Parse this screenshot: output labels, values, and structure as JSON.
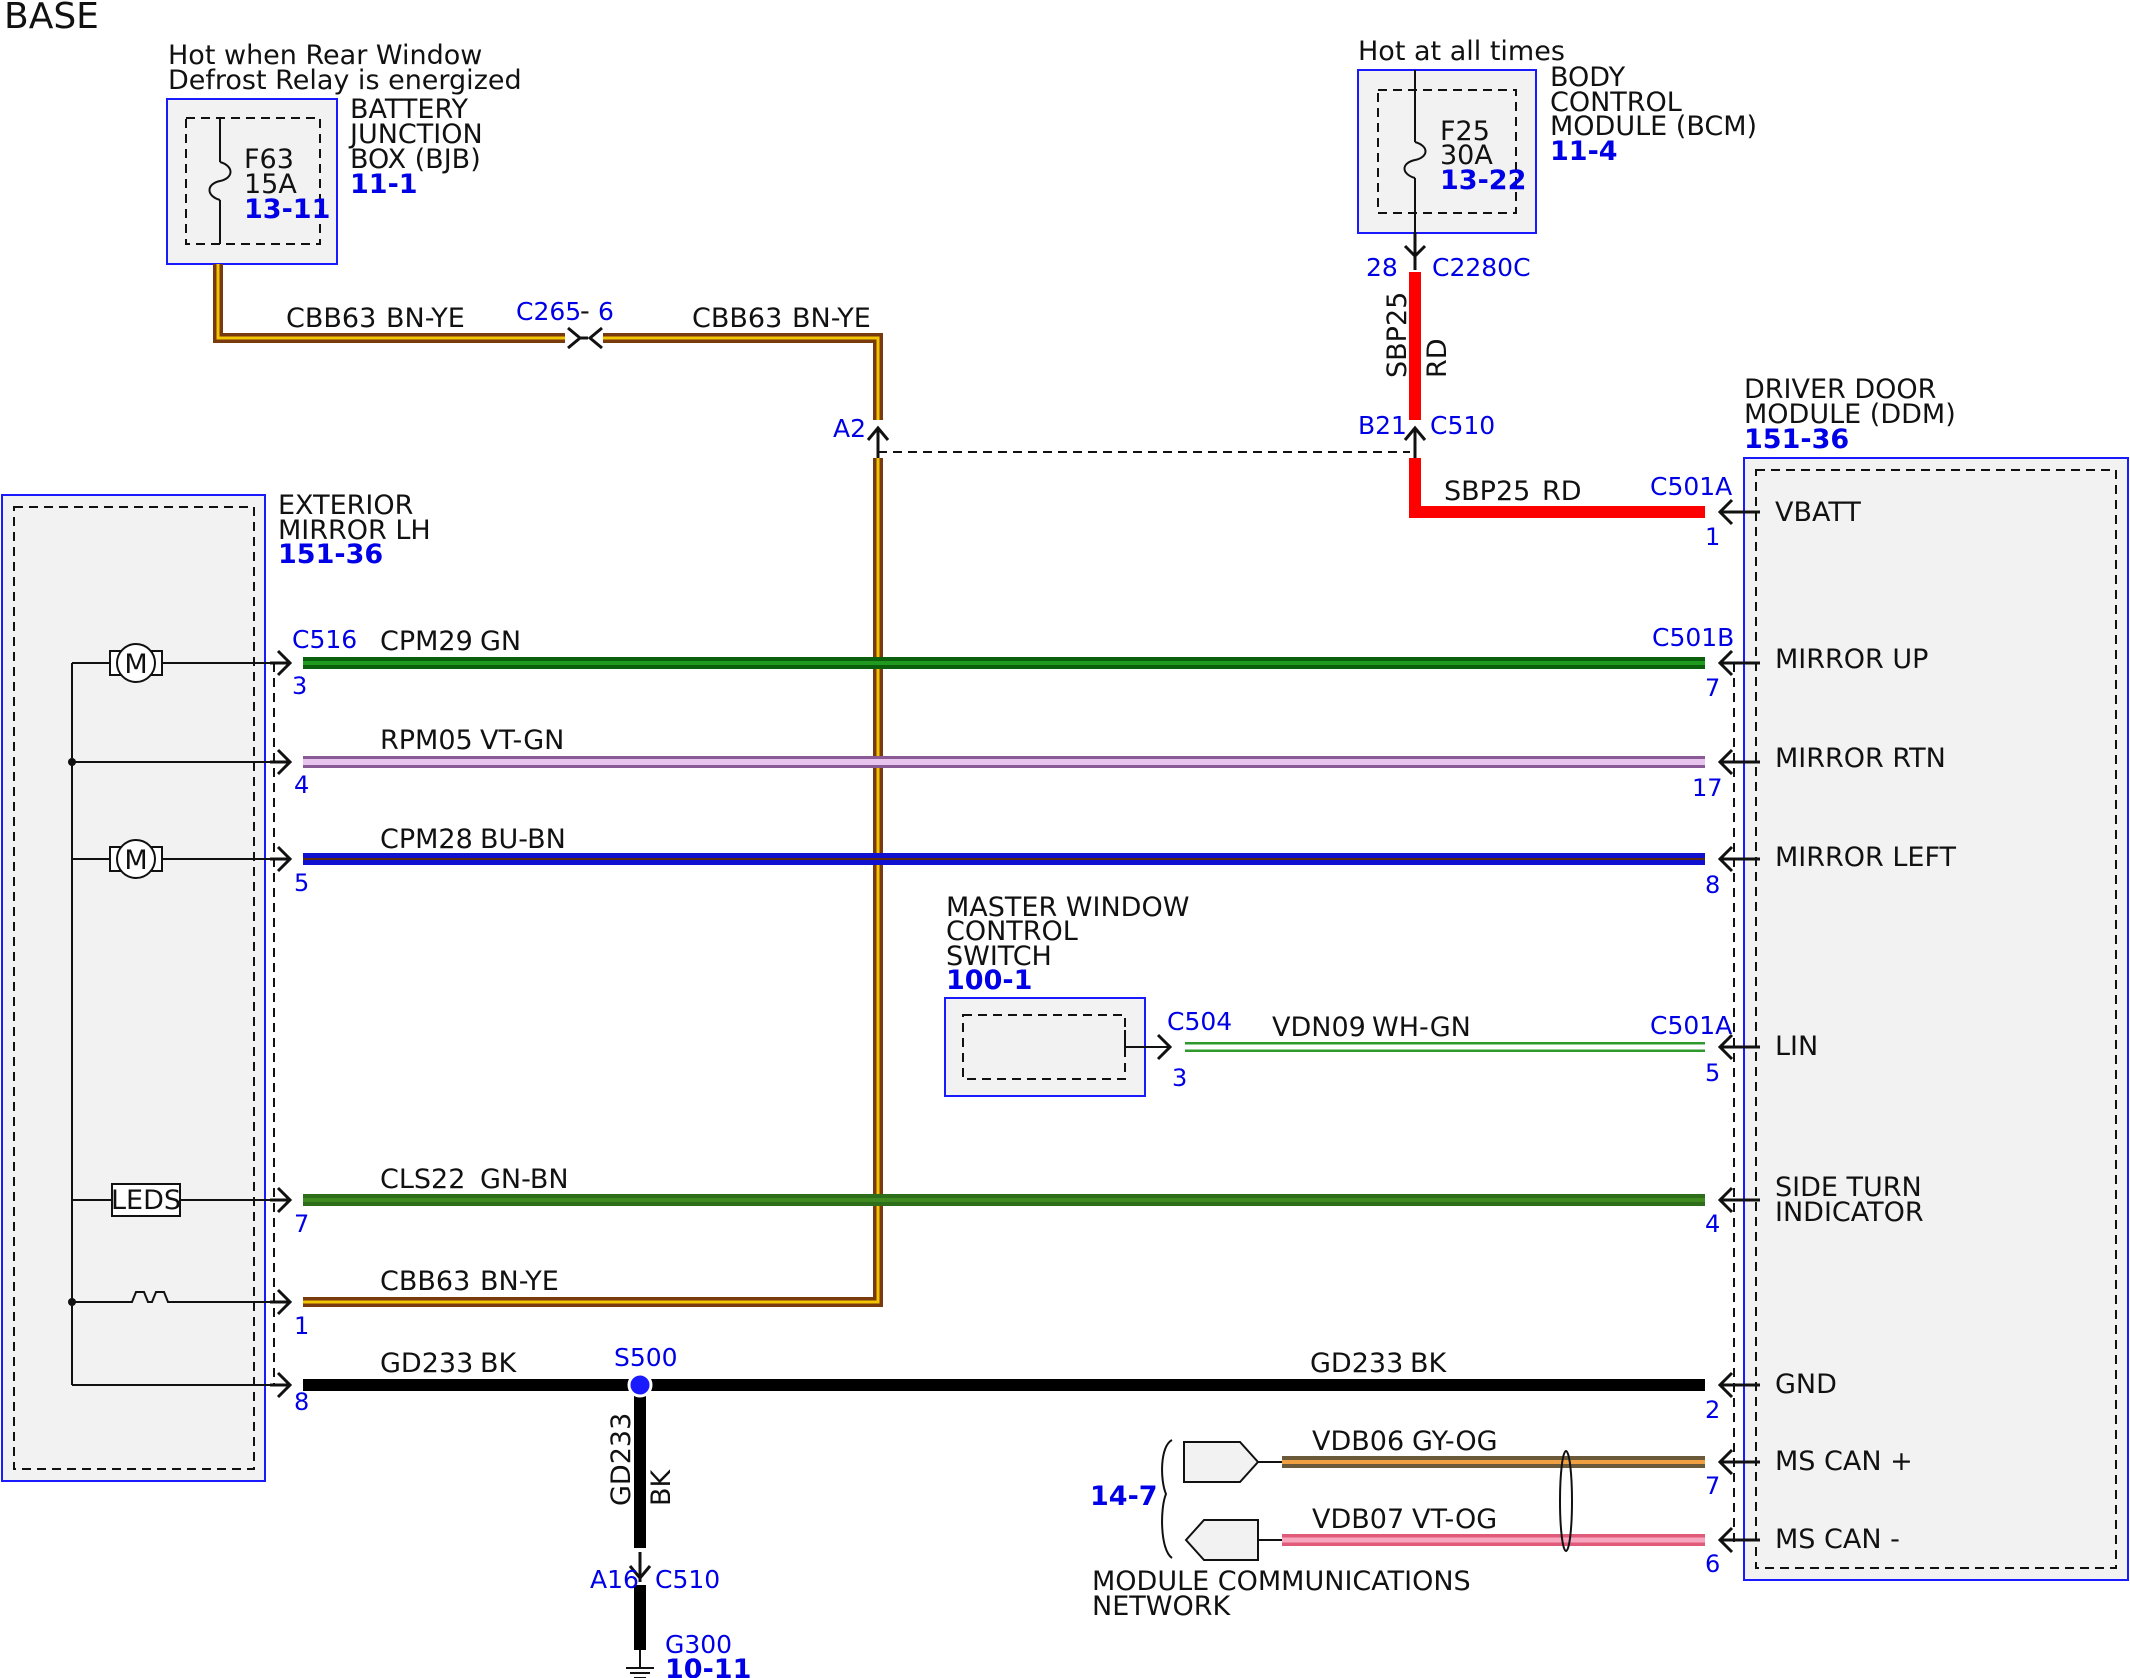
{
  "title": "BASE",
  "components": {
    "bjb": {
      "note_line1": "Hot when Rear Window",
      "note_line2": "Defrost Relay is energized",
      "name_line1": "BATTERY",
      "name_line2": "JUNCTION",
      "name_line3": "BOX (BJB)",
      "ref": "11-1",
      "fuse_name": "F63",
      "fuse_rating": "15A",
      "fuse_ref": "13-11"
    },
    "bcm": {
      "note": "Hot at all times",
      "name_line1": "BODY",
      "name_line2": "CONTROL",
      "name_line3": "MODULE (BCM)",
      "ref": "11-4",
      "fuse_name": "F25",
      "fuse_rating": "30A",
      "fuse_ref": "13-22"
    },
    "mirror": {
      "name_line1": "EXTERIOR",
      "name_line2": "MIRROR LH",
      "ref": "151-36",
      "motor_label": "M",
      "leds_label": "LEDS"
    },
    "ddm": {
      "name_line1": "DRIVER DOOR",
      "name_line2": "MODULE (DDM)",
      "ref": "151-36",
      "pins": {
        "vbatt": "VBATT",
        "mirror_up": "MIRROR UP",
        "mirror_rtn": "MIRROR RTN",
        "mirror_left": "MIRROR LEFT",
        "lin": "LIN",
        "side_turn_1": "SIDE TURN",
        "side_turn_2": "INDICATOR",
        "gnd": "GND",
        "ms_can_plus": "MS CAN +",
        "ms_can_minus": "MS CAN -"
      }
    },
    "mwcs": {
      "name_line1": "MASTER WINDOW",
      "name_line2": "CONTROL",
      "name_line3": "SWITCH",
      "ref": "100-1"
    },
    "network": {
      "ref": "14-7",
      "name_line1": "MODULE COMMUNICATIONS",
      "name_line2": "NETWORK"
    },
    "ground": {
      "name": "G300",
      "ref": "10-11"
    }
  },
  "connectors": {
    "c2280c": "C2280C",
    "c2280c_pin": "28",
    "c510": "C510",
    "c510_pin_b21": "B21",
    "c510_pin_a16": "A16",
    "c510_a16": "C510",
    "c510_pin_a2": "A2",
    "c501a_top": "C501A",
    "c501a_top_pin": "1",
    "c501b": "C501B",
    "c501b_pin": "7",
    "c501a_lin": "C501A",
    "c516": "C516",
    "c504": "C504",
    "c504_pin": "3",
    "c265": "C265",
    "c265_sep": "-",
    "c265_pin": "6",
    "s500": "S500",
    "mirror_pins": [
      "3",
      "4",
      "5",
      "7",
      "1",
      "8"
    ],
    "ddm_pins": [
      "17",
      "8",
      "5",
      "4",
      "2",
      "7",
      "6"
    ]
  },
  "wires": {
    "cbb63": "CBB63",
    "cbb63_color": "BN-YE",
    "sbp25": "SBP25",
    "sbp25_color": "RD",
    "cpm29": "CPM29",
    "cpm29_color": "GN",
    "rpm05": "RPM05",
    "rpm05_color": "VT-GN",
    "cpm28": "CPM28",
    "cpm28_color": "BU-BN",
    "vdn09": "VDN09",
    "vdn09_color": "WH-GN",
    "cls22": "CLS22",
    "cls22_color": "GN-BN",
    "gd233": "GD233",
    "gd233_color": "BK",
    "vdb06": "VDB06",
    "vdb06_color": "GY-OG",
    "vdb07": "VDB07",
    "vdb07_color": "VT-OG"
  },
  "colors": {
    "brown_yellow_outer": "#7a3a10",
    "brown_yellow_inner": "#f2c500",
    "red": "#ff0000",
    "green": "#157a15",
    "violet_green": "#c58fd2",
    "blue_brown": "#1010d0",
    "white_green": "#2e9a2e",
    "green_brown": "#2d6e1a",
    "black": "#000000",
    "gray_orange": "#9a8a6a",
    "violet_orange": "#f08aa8",
    "ref_blue": "#0000e6"
  }
}
